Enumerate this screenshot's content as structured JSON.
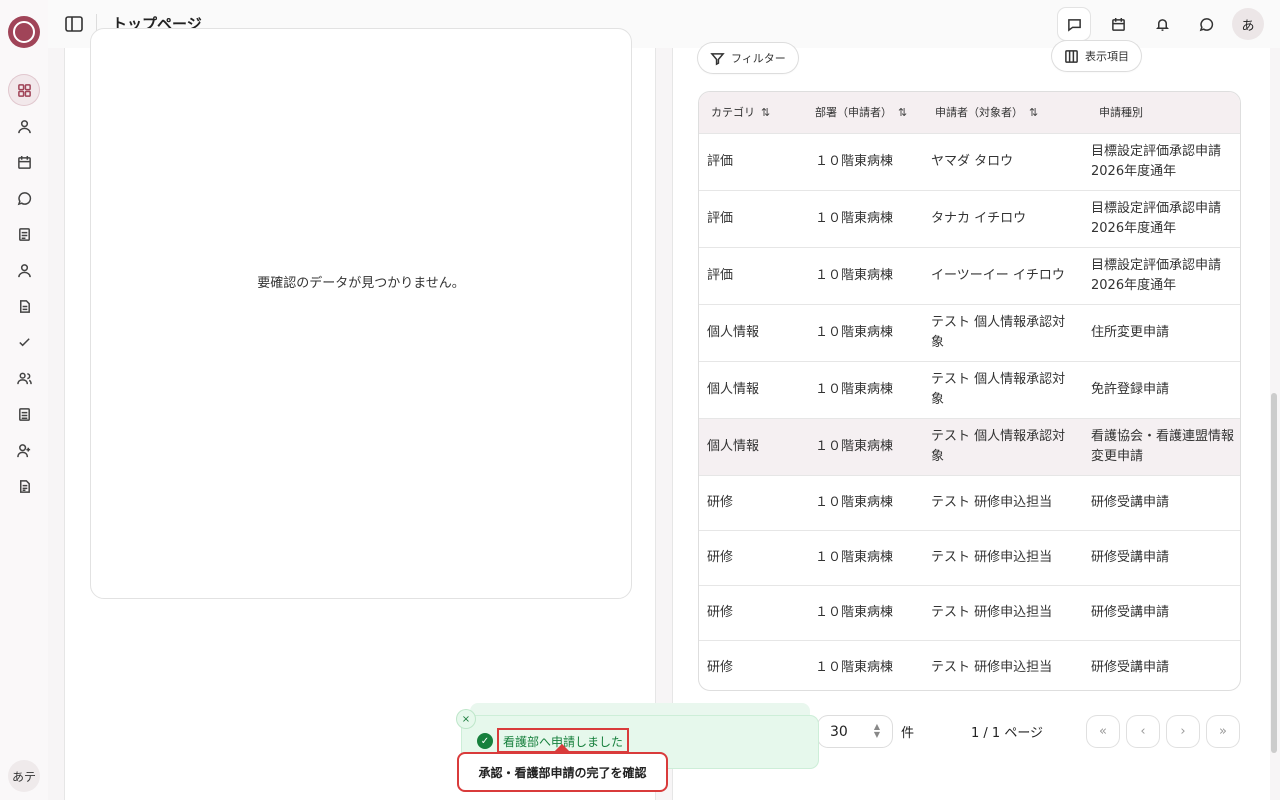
{
  "header": {
    "title": "トップページ",
    "user_initial": "あ"
  },
  "rail": {
    "user_label": "あテ"
  },
  "left_panel": {
    "empty_message": "要確認のデータが見つかりません。"
  },
  "right_panel": {
    "filter_label": "フィルター",
    "columns_label": "表示項目",
    "columns": [
      {
        "label": "カテゴリ",
        "sortable": true
      },
      {
        "label": "部署（申請者）",
        "sortable": true
      },
      {
        "label": "申請者（対象者）",
        "sortable": true
      },
      {
        "label": "申請種別",
        "sortable": false
      }
    ],
    "sort_glyph": "⇅",
    "rows": [
      {
        "category": "評価",
        "dept": "１０階東病棟",
        "applicant": "ヤマダ タロウ",
        "type": "目標設定評価承認申請 2026年度通年"
      },
      {
        "category": "評価",
        "dept": "１０階東病棟",
        "applicant": "タナカ イチロウ",
        "type": "目標設定評価承認申請 2026年度通年"
      },
      {
        "category": "評価",
        "dept": "１０階東病棟",
        "applicant": "イーツーイー イチロウ",
        "type": "目標設定評価承認申請 2026年度通年"
      },
      {
        "category": "個人情報",
        "dept": "１０階東病棟",
        "applicant": "テスト 個人情報承認対象",
        "type": "住所変更申請"
      },
      {
        "category": "個人情報",
        "dept": "１０階東病棟",
        "applicant": "テスト 個人情報承認対象",
        "type": "免許登録申請"
      },
      {
        "category": "個人情報",
        "dept": "１０階東病棟",
        "applicant": "テスト 個人情報承認対象",
        "type": "看護協会・看護連盟情報変更申請"
      },
      {
        "category": "研修",
        "dept": "１０階東病棟",
        "applicant": "テスト 研修申込担当",
        "type": "研修受講申請"
      },
      {
        "category": "研修",
        "dept": "１０階東病棟",
        "applicant": "テスト 研修申込担当",
        "type": "研修受講申請"
      },
      {
        "category": "研修",
        "dept": "１０階東病棟",
        "applicant": "テスト 研修申込担当",
        "type": "研修受講申請"
      },
      {
        "category": "研修",
        "dept": "１０階東病棟",
        "applicant": "テスト 研修申込担当",
        "type": "研修受講申請"
      }
    ],
    "pagination": {
      "per_page": "30",
      "unit": "件",
      "page_info": "1 / 1 ページ",
      "first": "«",
      "prev": "‹",
      "next": "›",
      "last": "»"
    }
  },
  "toast": {
    "message": "看護部へ申請しました",
    "close": "×",
    "check": "✓"
  },
  "callout": {
    "text": "承認・看護部申請の完了を確認"
  },
  "colors": {
    "brand": "#a04458",
    "success": "#17803d",
    "highlight_border": "#d93b3b"
  }
}
